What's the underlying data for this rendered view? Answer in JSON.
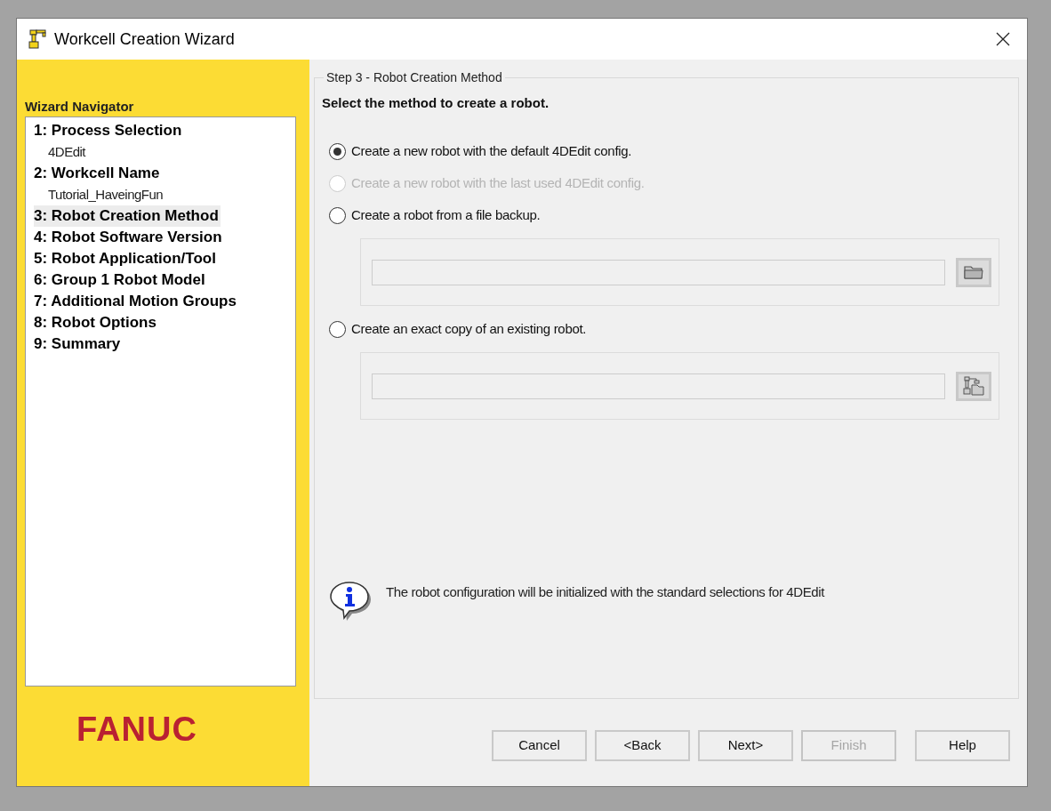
{
  "window": {
    "title": "Workcell Creation Wizard"
  },
  "navigator": {
    "title": "Wizard Navigator",
    "items": [
      {
        "kind": "step",
        "label": "1: Process Selection",
        "selected": false
      },
      {
        "kind": "detail",
        "label": "4DEdit"
      },
      {
        "kind": "step",
        "label": "2: Workcell Name",
        "selected": false
      },
      {
        "kind": "detail",
        "label": "Tutorial_HaveingFun"
      },
      {
        "kind": "step",
        "label": "3: Robot Creation Method",
        "selected": true
      },
      {
        "kind": "step",
        "label": "4: Robot Software Version",
        "selected": false
      },
      {
        "kind": "step",
        "label": "5: Robot Application/Tool",
        "selected": false
      },
      {
        "kind": "step",
        "label": "6: Group 1 Robot Model",
        "selected": false
      },
      {
        "kind": "step",
        "label": "7: Additional Motion Groups",
        "selected": false
      },
      {
        "kind": "step",
        "label": "8: Robot Options",
        "selected": false
      },
      {
        "kind": "step",
        "label": "9: Summary",
        "selected": false
      }
    ]
  },
  "logo": "FANUC",
  "step": {
    "legend": "Step 3 - Robot Creation Method",
    "heading": "Select the method to create a robot.",
    "options": [
      {
        "kind": "plain",
        "label": "Create a new robot with the default 4DEdit config.",
        "selected": true,
        "disabled": false
      },
      {
        "kind": "plain",
        "label": "Create a new robot with the last used 4DEdit config.",
        "selected": false,
        "disabled": true
      },
      {
        "kind": "folder",
        "label": "Create a robot from a file backup.",
        "selected": false,
        "disabled": false
      },
      {
        "kind": "robot",
        "label": "Create an exact copy of an existing robot.",
        "selected": false,
        "disabled": false
      }
    ],
    "info": "The robot configuration will be initialized with the standard selections for 4DEdit"
  },
  "buttons": [
    {
      "label": "Cancel",
      "disabled": false
    },
    {
      "label": "<Back",
      "disabled": false
    },
    {
      "label": "Next>",
      "disabled": false
    },
    {
      "label": "Finish",
      "disabled": true
    },
    {
      "label": "Help",
      "disabled": false
    }
  ]
}
